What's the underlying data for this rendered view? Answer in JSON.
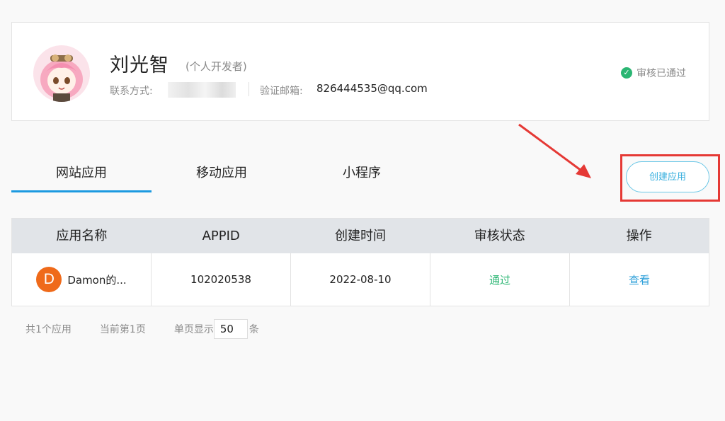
{
  "profile": {
    "avatar_icon": "anime-girl-avatar",
    "name": "刘光智",
    "role": "(个人开发者)",
    "contact_label": "联系方式:",
    "email_label": "验证邮箱:",
    "email": "826444535@qq.com",
    "status": "审核已通过",
    "status_color": "#2bb673"
  },
  "tabs": [
    {
      "label": "网站应用",
      "active": true
    },
    {
      "label": "移动应用",
      "active": false
    },
    {
      "label": "小程序",
      "active": false
    }
  ],
  "create_button": {
    "label": "创建应用"
  },
  "annotation": {
    "highlight_color": "#e53935"
  },
  "table": {
    "headers": [
      "应用名称",
      "APPID",
      "创建时间",
      "审核状态",
      "操作"
    ],
    "rows": [
      {
        "logo_letter": "D",
        "name": "Damon的...",
        "appid": "102020538",
        "created": "2022-08-10",
        "status": "通过",
        "action": "查看"
      }
    ]
  },
  "pager": {
    "total": "共1个应用",
    "current": "当前第1页",
    "per_page_label": "单页显示",
    "per_page_value": "50",
    "unit": "条"
  },
  "colors": {
    "accent": "#1c9ae0",
    "logo_bg": "#ef6a1a",
    "link": "#2d9fd9"
  }
}
